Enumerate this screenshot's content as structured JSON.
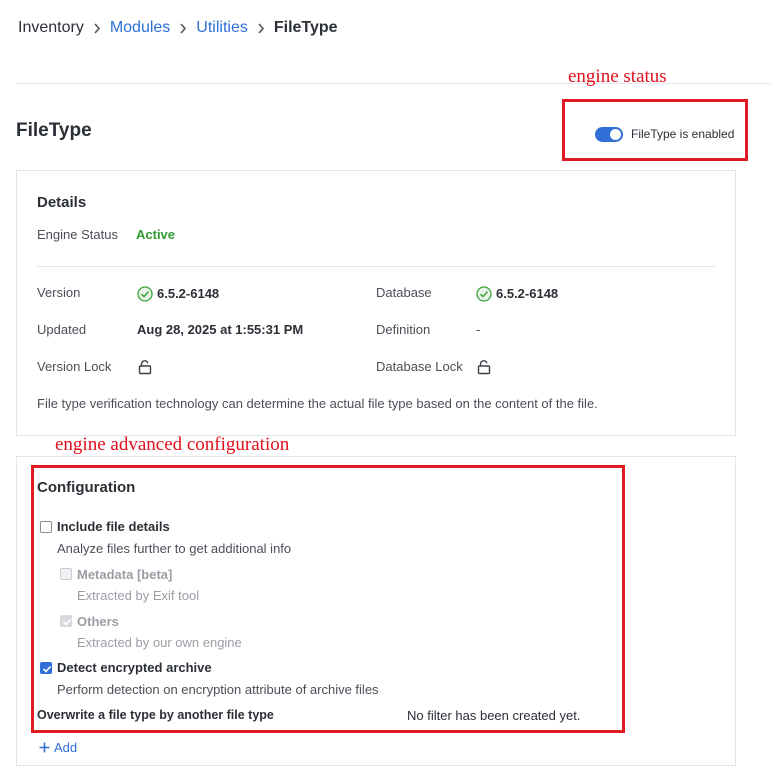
{
  "breadcrumb": {
    "items": [
      "Inventory",
      "Modules",
      "Utilities",
      "FileType"
    ]
  },
  "annotations": {
    "engine_status": "engine status",
    "advanced_config": "engine advanced configuration"
  },
  "header": {
    "title": "FileType",
    "toggle_label": "FileType is enabled",
    "toggle_on": true
  },
  "details": {
    "heading": "Details",
    "engine_status_label": "Engine Status",
    "engine_status_value": "Active",
    "version_label": "Version",
    "version_value": "6.5.2-6148",
    "database_label": "Database",
    "database_value": "6.5.2-6148",
    "updated_label": "Updated",
    "updated_value": "Aug 28, 2025 at 1:55:31 PM",
    "definition_label": "Definition",
    "definition_value": "-",
    "version_lock_label": "Version Lock",
    "database_lock_label": "Database Lock",
    "description": "File type verification technology can determine the actual file type based on the content of the file."
  },
  "configuration": {
    "heading": "Configuration",
    "include_details": {
      "label": "Include file details",
      "sub": "Analyze files further to get additional info",
      "checked": false
    },
    "metadata": {
      "label": "Metadata [beta]",
      "sub": "Extracted by Exif tool",
      "checked": false
    },
    "others": {
      "label": "Others",
      "sub": "Extracted by our own engine",
      "checked": true
    },
    "detect_encrypted": {
      "label": "Detect encrypted archive",
      "sub": "Perform detection on encryption attribute of archive files",
      "checked": true
    },
    "overwrite_label": "Overwrite a file type by another file type",
    "no_filter": "No filter has been created yet.",
    "add_label": "Add"
  },
  "colors": {
    "accent": "#2f6fd6",
    "active": "#2f9a2f",
    "annotation": "#e0101c"
  }
}
